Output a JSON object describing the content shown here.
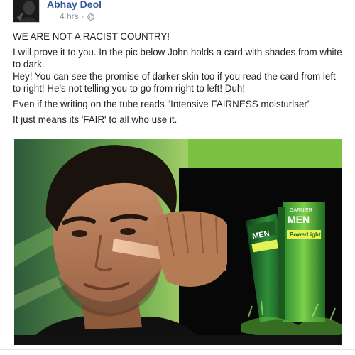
{
  "post": {
    "author": "Abhay Deol",
    "time": "4 hrs",
    "separator": "·",
    "paragraphs": [
      "WE ARE NOT A RACIST COUNTRY!",
      "I will prove it to you. In the pic below John holds a card with shades from white to dark.",
      "Hey! You can see the promise of darker skin too if you read the card from left to right! He's not telling you to go from right to left! Duh!",
      "Even if the writing on the tube reads \"Intensive FAIRNESS moisturiser\".",
      "It just means its 'FAIR' to all who use it."
    ]
  },
  "ad": {
    "brand": "GARNIER",
    "product_line": "MEN",
    "product_name": "PowerLight"
  },
  "icons": {
    "audience": "globe-icon"
  },
  "colors": {
    "link": "#365899",
    "meta": "#90949c",
    "ad_green": "#7cc242"
  }
}
